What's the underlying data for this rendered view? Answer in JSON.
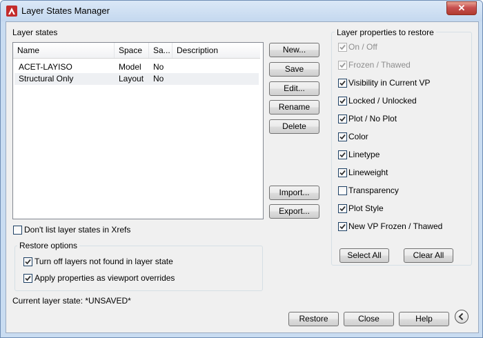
{
  "window": {
    "title": "Layer States Manager",
    "close_label": "✕"
  },
  "layer_states": {
    "section_label": "Layer states",
    "columns": [
      "Name",
      "Space",
      "Sa...",
      "Description"
    ],
    "rows": [
      {
        "name": "ACET-LAYISO",
        "space": "Model",
        "saved": "No",
        "description": ""
      },
      {
        "name": "Structural Only",
        "space": "Layout",
        "saved": "No",
        "description": ""
      }
    ]
  },
  "side_buttons": {
    "new": "New...",
    "save": "Save",
    "edit": "Edit...",
    "rename": "Rename",
    "delete": "Delete",
    "import": "Import...",
    "export": "Export..."
  },
  "xrefs": {
    "label": "Don't list layer states in Xrefs",
    "checked": false
  },
  "restore_options": {
    "title": "Restore options",
    "turn_off": {
      "label": "Turn off layers not found in layer state",
      "checked": true
    },
    "apply_props": {
      "label": "Apply properties as viewport overrides",
      "checked": true
    }
  },
  "current_state": "Current layer state: *UNSAVED*",
  "properties": {
    "title": "Layer properties to restore",
    "items": [
      {
        "label": "On / Off",
        "checked": true,
        "disabled": true
      },
      {
        "label": "Frozen / Thawed",
        "checked": true,
        "disabled": true
      },
      {
        "label": "Visibility in Current VP",
        "checked": true,
        "disabled": false
      },
      {
        "label": "Locked / Unlocked",
        "checked": true,
        "disabled": false
      },
      {
        "label": "Plot / No Plot",
        "checked": true,
        "disabled": false
      },
      {
        "label": "Color",
        "checked": true,
        "disabled": false
      },
      {
        "label": "Linetype",
        "checked": true,
        "disabled": false
      },
      {
        "label": "Lineweight",
        "checked": true,
        "disabled": false
      },
      {
        "label": "Transparency",
        "checked": false,
        "disabled": false
      },
      {
        "label": "Plot Style",
        "checked": true,
        "disabled": false
      },
      {
        "label": "New VP Frozen / Thawed",
        "checked": true,
        "disabled": false
      }
    ],
    "select_all": "Select All",
    "clear_all": "Clear All"
  },
  "footer": {
    "restore": "Restore",
    "close": "Close",
    "help": "Help"
  },
  "colors": {
    "accent": "#c32c2c",
    "checkmark": "#333333",
    "window_frame": "#c9dcf1"
  }
}
